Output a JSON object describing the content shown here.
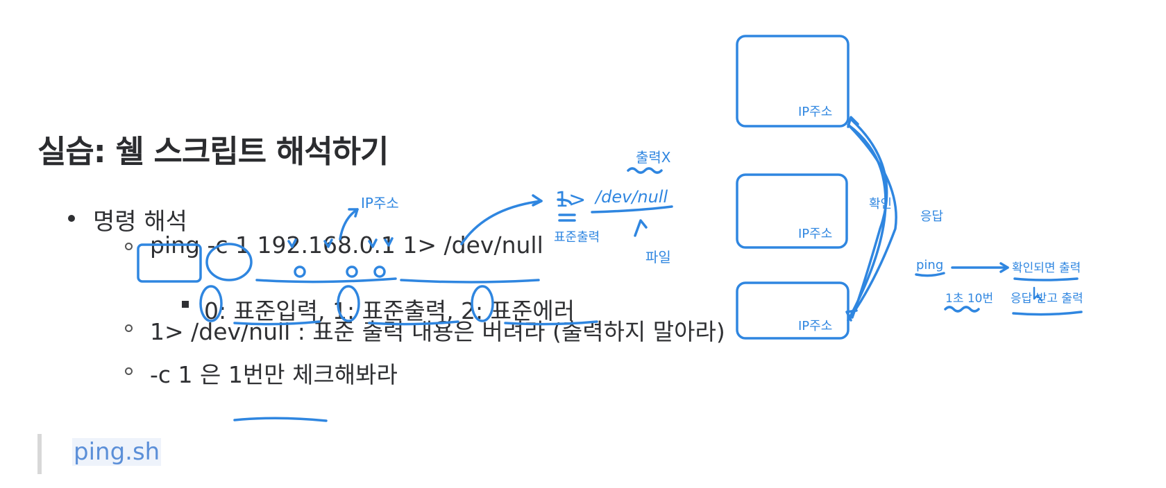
{
  "title": "실습: 쉘 스크립트 해석하기",
  "bullet1": "명령 해석",
  "command": "ping -c 1 192.168.0.1 1> /dev/null",
  "streams": "0: 표준입력, 1: 표준출력, 2: 표준에러",
  "redirect_note": "1> /dev/null : 표준 출력 내용은 버려라 (출력하지 말아라)",
  "count_note": "-c 1 은 1번만 체크해봐라",
  "file": "ping.sh",
  "annotations": {
    "ip_label": "IP주소",
    "redirect": "1>",
    "devnull": "/dev/null",
    "no_output": "출력X",
    "stdout_short": "표준출력",
    "file_word": "파일",
    "confirm": "확인",
    "response": "응답",
    "ping": "ping",
    "confirm_output": "확인되면 출력",
    "once_ten": "1초 10번",
    "response_output": "응답 받고 출력",
    "ink_color": "#2f86e0"
  }
}
